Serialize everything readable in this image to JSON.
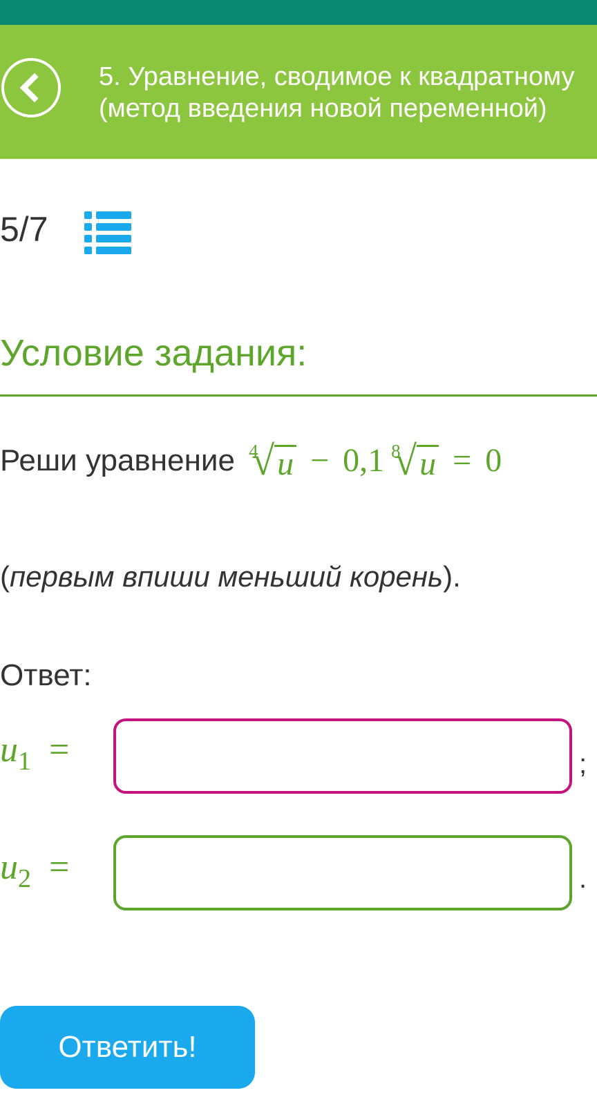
{
  "header": {
    "back_icon": "chevron-left-icon",
    "title_line1": "5. Уравнение, сводимое к квадратному",
    "title_line2": "(метод введения новой переменной)"
  },
  "progress": {
    "text": "5/7",
    "list_icon": "list-icon"
  },
  "section": {
    "title": "Условие задания:"
  },
  "task": {
    "prefix": "Реши уравнение ",
    "equation": {
      "root1_index": "4",
      "root1_radicand": "u",
      "minus": "−",
      "coefficient": "0,1",
      "root2_index": "8",
      "root2_radicand": "u",
      "equals": "=",
      "rhs": "0"
    },
    "hint_open": "(",
    "hint_text": "первым впиши меньший корень",
    "hint_close": ")."
  },
  "answer": {
    "label": "Ответ:",
    "fields": [
      {
        "var": "u",
        "sub": "1",
        "eq": "=",
        "value": "",
        "punct": ";"
      },
      {
        "var": "u",
        "sub": "2",
        "eq": "=",
        "value": "",
        "punct": "."
      }
    ]
  },
  "submit": {
    "label": "Ответить!"
  },
  "colors": {
    "status_bar": "#0a8870",
    "header": "#8cc63f",
    "accent_green": "#5ea52c",
    "accent_blue": "#1aa9ec",
    "first_input_border": "#c5137e"
  }
}
